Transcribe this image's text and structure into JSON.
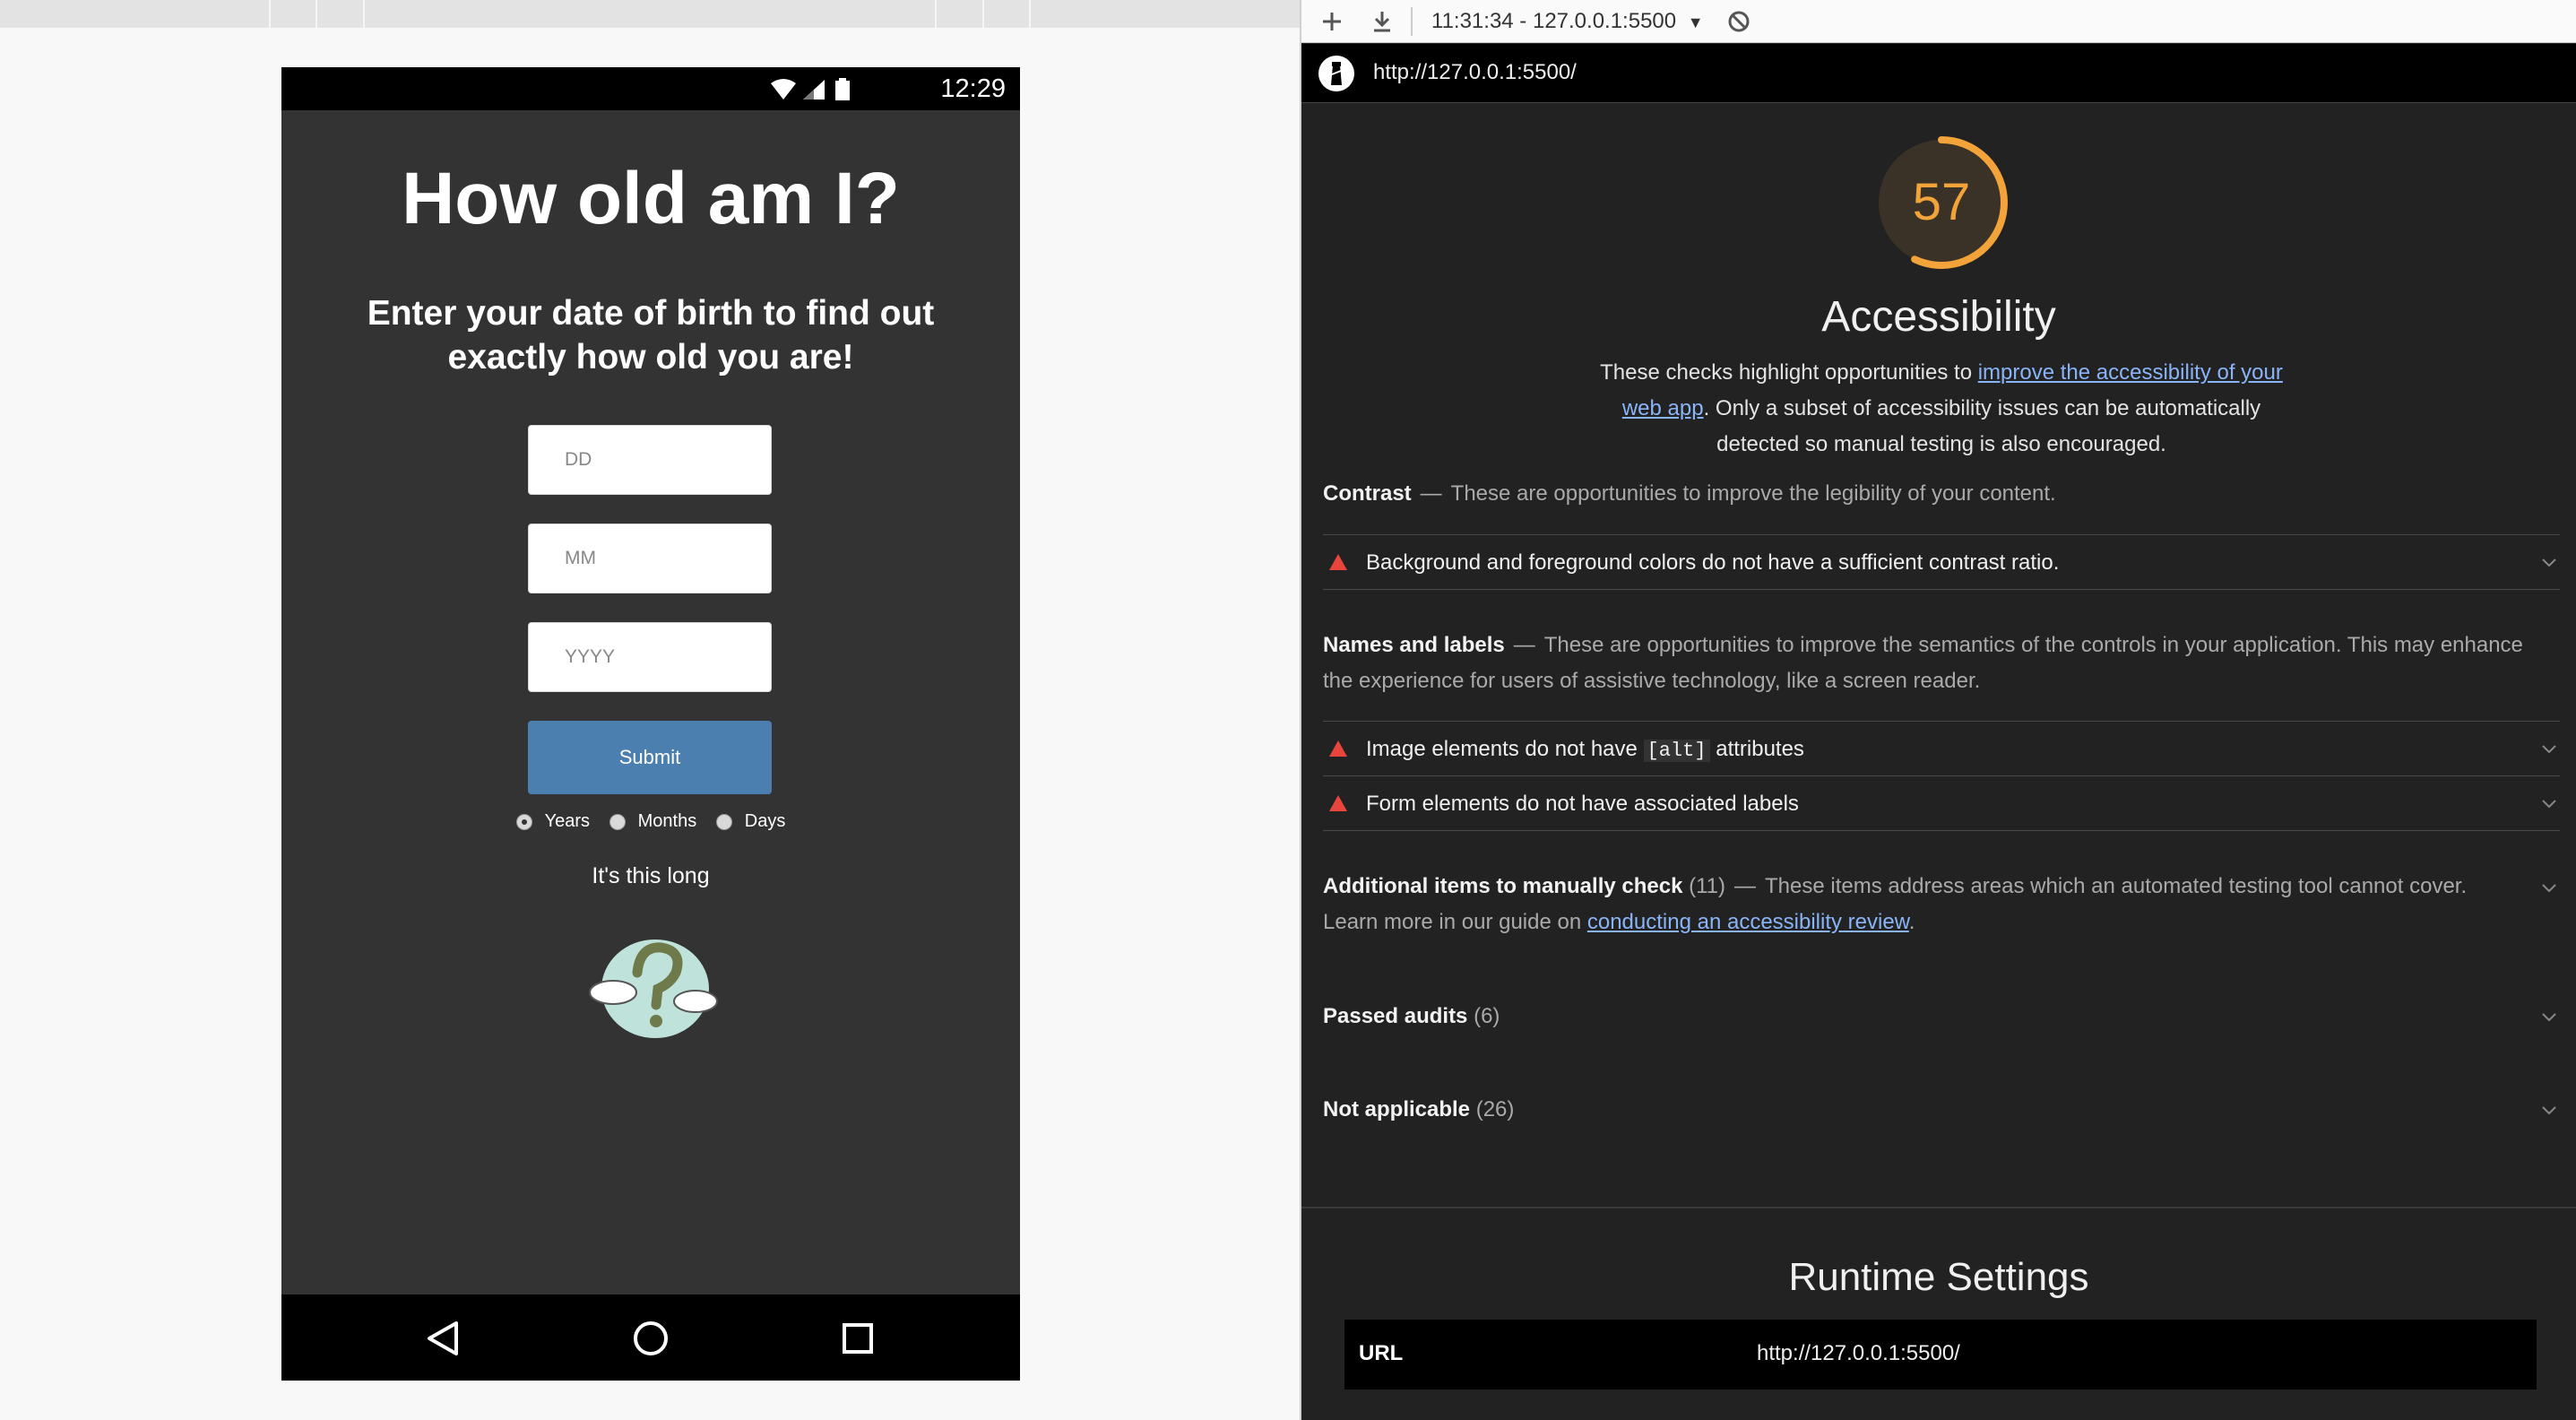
{
  "device": {
    "status_time": "12:29",
    "app": {
      "title": "How old am I?",
      "subtitle": "Enter your date of birth to find out exactly how old you are!",
      "inputs": {
        "day_placeholder": "DD",
        "month_placeholder": "MM",
        "year_placeholder": "YYYY"
      },
      "submit_label": "Submit",
      "units": [
        {
          "label": "Years",
          "checked": true
        },
        {
          "label": "Months",
          "checked": false
        },
        {
          "label": "Days",
          "checked": false
        }
      ],
      "result_text": "It's this long"
    },
    "icons": {
      "wifi": "wifi-icon",
      "signal": "signal-icon",
      "battery": "battery-icon",
      "back": "back-triangle-icon",
      "home": "home-circle-icon",
      "recents": "recents-square-icon",
      "result_image": "question-cloud-image"
    }
  },
  "lighthouse": {
    "toolbar": {
      "report_selector": "11:31:34 - 127.0.0.1:5500"
    },
    "url": "http://127.0.0.1:5500/",
    "score": 57,
    "score_color": "#f2a33a",
    "warn_color": "#e8453c",
    "category": {
      "title": "Accessibility",
      "desc_prefix": "These checks highlight opportunities to ",
      "desc_link": "improve the accessibility of your web app",
      "desc_suffix": ". Only a subset of accessibility issues can be automatically detected so manual testing is also encouraged."
    },
    "groups": {
      "contrast": {
        "title": "Contrast",
        "desc": "These are opportunities to improve the legibility of your content.",
        "audits": [
          "Background and foreground colors do not have a sufficient contrast ratio."
        ]
      },
      "names": {
        "title": "Names and labels",
        "desc": "These are opportunities to improve the semantics of the controls in your application. This may enhance the experience for users of assistive technology, like a screen reader.",
        "audit_alt_prefix": "Image elements do not have ",
        "audit_alt_code": "[alt]",
        "audit_alt_suffix": " attributes",
        "audit_labels": "Form elements do not have associated labels"
      },
      "manual": {
        "title": "Additional items to manually check",
        "count": "(11)",
        "desc_prefix": "These items address areas which an automated testing tool cannot cover. Learn more in our guide on ",
        "desc_link": "conducting an accessibility review",
        "desc_suffix": "."
      },
      "passed": {
        "title": "Passed audits",
        "count": "(6)"
      },
      "not_applicable": {
        "title": "Not applicable",
        "count": "(26)"
      }
    },
    "runtime": {
      "title": "Runtime Settings",
      "rows": [
        {
          "key": "URL",
          "value": "http://127.0.0.1:5500/"
        }
      ]
    }
  }
}
